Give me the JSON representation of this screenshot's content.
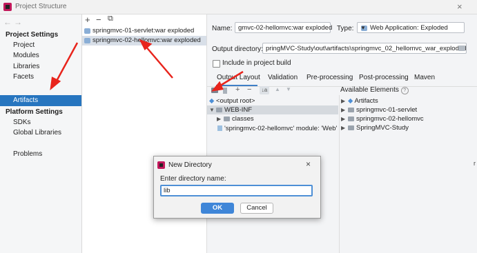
{
  "window": {
    "title": "Project Structure",
    "close": "×"
  },
  "nav": {
    "back": "←",
    "forward": "→",
    "project_settings_header": "Project Settings",
    "project_settings_items": [
      "Project",
      "Modules",
      "Libraries",
      "Facets",
      "Artifacts"
    ],
    "platform_settings_header": "Platform Settings",
    "platform_settings_items": [
      "SDKs",
      "Global Libraries"
    ],
    "problems": "Problems",
    "selected": "Artifacts"
  },
  "list_toolbar": {
    "add": "+",
    "remove": "−",
    "copy": "⧉"
  },
  "artifacts": [
    "springmvc-01-servlet:war exploded",
    "springmvc-02-hellomvc:war exploded"
  ],
  "detail": {
    "name_label": "Name:",
    "name_value": "gmvc-02-hellomvc:war exploded",
    "type_label": "Type:",
    "type_value": "Web Application: Exploded",
    "output_dir_label": "Output directory:",
    "output_dir_value": "pringMVC-Study\\out\\artifacts\\springmvc_02_hellomvc_war_exploded",
    "include_build_label": "Include in project build",
    "include_build_checked": false
  },
  "tabs": [
    "Output Layout",
    "Validation",
    "Pre-processing",
    "Post-processing",
    "Maven"
  ],
  "active_tab": "Output Layout",
  "layout_toolbar": {
    "sort": "↓a",
    "up": "▲",
    "down": "▼",
    "add": "+",
    "remove": "−"
  },
  "output_tree": {
    "root": "<output root>",
    "web_inf": "WEB-INF",
    "classes": "classes",
    "module_output": "'springmvc-02-hellomvc' module: 'Web' fac"
  },
  "available": {
    "header": "Available Elements",
    "help": "?",
    "items": [
      "Artifacts",
      "springmvc-01-servlet",
      "springmvc-02-hellomvc",
      "SpringMVC-Study"
    ]
  },
  "dialog": {
    "title": "New Directory",
    "close": "×",
    "prompt": "Enter directory name:",
    "input_value": "lib",
    "ok": "OK",
    "cancel": "Cancel"
  },
  "colors": {
    "selection": "#2675bf",
    "primary_button": "#3f86d8",
    "annotation": "#e8241c"
  }
}
